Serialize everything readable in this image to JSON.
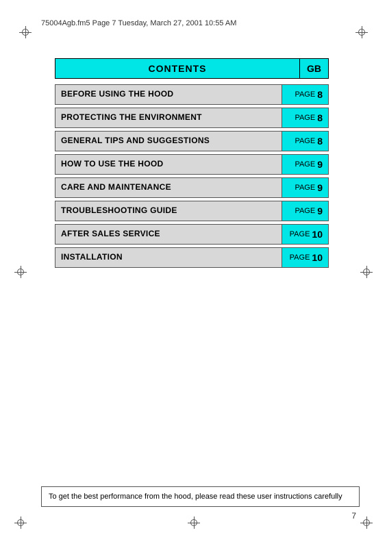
{
  "header": {
    "text": "75004Agb.fm5  Page 7  Tuesday, March 27, 2001  10:55 AM"
  },
  "contents": {
    "title": "CONTENTS",
    "gb_label": "GB",
    "rows": [
      {
        "label": "BEFORE USING THE HOOD",
        "page_word": "PAGE",
        "page_num": "8"
      },
      {
        "label": "PROTECTING THE ENVIRONMENT",
        "page_word": "PAGE",
        "page_num": "8"
      },
      {
        "label": "GENERAL TIPS AND SUGGESTIONS",
        "page_word": "PAGE",
        "page_num": "8"
      },
      {
        "label": "HOW TO USE THE HOOD",
        "page_word": "PAGE",
        "page_num": "9"
      },
      {
        "label": "CARE AND MAINTENANCE",
        "page_word": "PAGE",
        "page_num": "9"
      },
      {
        "label": "TROUBLESHOOTING GUIDE",
        "page_word": "PAGE",
        "page_num": "9"
      },
      {
        "label": "AFTER SALES SERVICE",
        "page_word": "PAGE",
        "page_num": "10"
      },
      {
        "label": "INSTALLATION",
        "page_word": "PAGE",
        "page_num": "10"
      }
    ]
  },
  "footer": {
    "note": "To get the best performance from the hood, please read these user instructions carefully"
  },
  "page_number": "7"
}
